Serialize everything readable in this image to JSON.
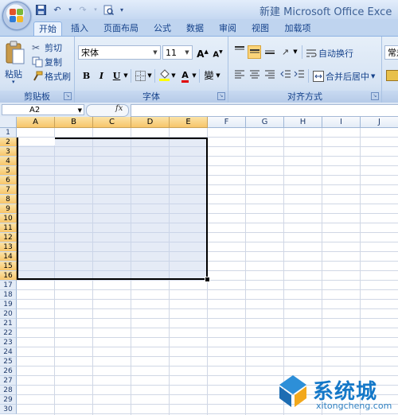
{
  "window": {
    "title": "新建 Microsoft Office Exce"
  },
  "tabs": [
    {
      "label": "开始",
      "active": true
    },
    {
      "label": "插入"
    },
    {
      "label": "页面布局"
    },
    {
      "label": "公式"
    },
    {
      "label": "数据"
    },
    {
      "label": "审阅"
    },
    {
      "label": "视图"
    },
    {
      "label": "加载项"
    }
  ],
  "ribbon": {
    "clipboard": {
      "label": "剪贴板",
      "paste": "粘贴",
      "cut": "剪切",
      "copy": "复制",
      "format_painter": "格式刷"
    },
    "font": {
      "label": "字体",
      "font_name": "宋体",
      "font_size": "11",
      "bold": "B",
      "italic": "I",
      "underline": "U",
      "grow": "A",
      "shrink": "A",
      "color_letter": "A",
      "phonetic": "變"
    },
    "alignment": {
      "label": "对齐方式",
      "wrap_text": "自动换行",
      "merge_center": "合并后居中"
    },
    "number": {
      "format": "常规"
    }
  },
  "formula_bar": {
    "name_box": "A2",
    "fx": "fx",
    "value": ""
  },
  "grid": {
    "columns": [
      "A",
      "B",
      "C",
      "D",
      "E",
      "F",
      "G",
      "H",
      "I",
      "J"
    ],
    "selected_columns": [
      "A",
      "B",
      "C",
      "D",
      "E"
    ],
    "rows": [
      "1",
      "2",
      "3",
      "4",
      "5",
      "6",
      "7",
      "8",
      "9",
      "10",
      "11",
      "12",
      "13",
      "14",
      "15",
      "16",
      "17",
      "18",
      "19",
      "20",
      "21",
      "22",
      "23",
      "24",
      "25",
      "26",
      "27",
      "28",
      "29",
      "30"
    ],
    "selected_rows": [
      "2",
      "3",
      "4",
      "5",
      "6",
      "7",
      "8",
      "9",
      "10",
      "11",
      "12",
      "13",
      "14",
      "15",
      "16"
    ]
  },
  "watermark": {
    "text": "系统城",
    "url": "xitongcheng.com"
  },
  "colors": {
    "ribbon_bg": "#d7e4f4",
    "selection_header": "#f7c56a",
    "selection_fill": "#c5d3eb",
    "watermark_blue": "#1478c8"
  }
}
